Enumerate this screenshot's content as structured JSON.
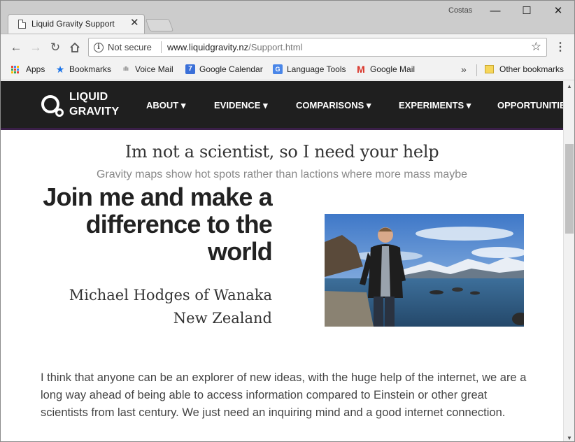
{
  "browser": {
    "tab_title": "Liquid Gravity Support",
    "profile_name": "Costas",
    "security_label": "Not secure",
    "url_host": "www.liquidgravity.nz",
    "url_path": "/Support.html"
  },
  "bookmarks": {
    "items": [
      {
        "label": "Apps",
        "icon": "apps-grid-icon"
      },
      {
        "label": "Bookmarks",
        "icon": "star-icon"
      },
      {
        "label": "Voice Mail",
        "icon": "cisco-icon"
      },
      {
        "label": "Google Calendar",
        "icon": "calendar-icon",
        "icon_text": "7"
      },
      {
        "label": "Language Tools",
        "icon": "translate-icon"
      },
      {
        "label": "Google Mail",
        "icon": "gmail-icon"
      }
    ],
    "more_label": "»",
    "other_label": "Other bookmarks"
  },
  "site": {
    "logo_line1": "LIQUID",
    "logo_line2": "GRAVITY",
    "nav": [
      {
        "label": "ABOUT ▾"
      },
      {
        "label": "EVIDENCE ▾"
      },
      {
        "label": "COMPARISONS ▾"
      },
      {
        "label": "EXPERIMENTS ▾"
      },
      {
        "label": "OPPORTUNITIE"
      }
    ],
    "nav_bg": "#1f1f1f"
  },
  "content": {
    "heading": "Im not a scientist, so I need your help",
    "subheading": "Gravity maps show hot spots rather than lactions where more mass maybe",
    "hero_title": "Join me and make a difference to the world",
    "name_line1": "Michael Hodges of Wanaka",
    "name_line2": "New Zealand",
    "paragraph": "I think that anyone can be an explorer of new ideas, with the huge help of the internet, we are a long way ahead of being able to access information compared to Einstein or other great scientists from last century. We just need an inquiring mind and a good internet connection."
  }
}
